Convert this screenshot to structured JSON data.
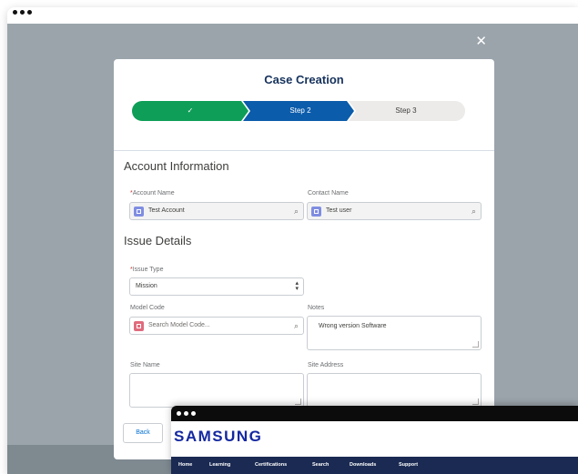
{
  "modal": {
    "title": "Case Creation",
    "close_icon": "close-icon",
    "path": {
      "steps": [
        {
          "label": "✓",
          "state": "complete",
          "color": "#04844b"
        },
        {
          "label": "Step 2",
          "state": "current",
          "color": "#0b5cab"
        },
        {
          "label": "Step 3",
          "state": "incomplete",
          "color": "#ecebea"
        }
      ]
    },
    "account_section": {
      "title": "Account Information",
      "account_name": {
        "label": "Account Name",
        "required": "*",
        "value": "Test Account",
        "icon": "account-icon"
      },
      "contact_name": {
        "label": "Contact Name",
        "value": "Test user",
        "icon": "contact-icon"
      }
    },
    "issue_section": {
      "title": "Issue Details",
      "issue_type": {
        "label": "Issue Type",
        "required": "*",
        "value": "Mission"
      },
      "model_code": {
        "label": "Model Code",
        "placeholder": "Search Model Code...",
        "icon": "product-icon"
      },
      "notes": {
        "label": "Notes",
        "value": "Wrong version Software"
      },
      "site_name": {
        "label": "Site Name",
        "value": ""
      },
      "site_address": {
        "label": "Site Address",
        "value": ""
      }
    },
    "footer": {
      "back_label": "Back"
    }
  },
  "samsung_window": {
    "logo": "SAMSUNG",
    "nav": [
      "Home",
      "Learning",
      "Certifications",
      "Search",
      "Downloads",
      "Support"
    ],
    "brand_color": "#1428a0",
    "nav_color": "#1a2a52"
  }
}
